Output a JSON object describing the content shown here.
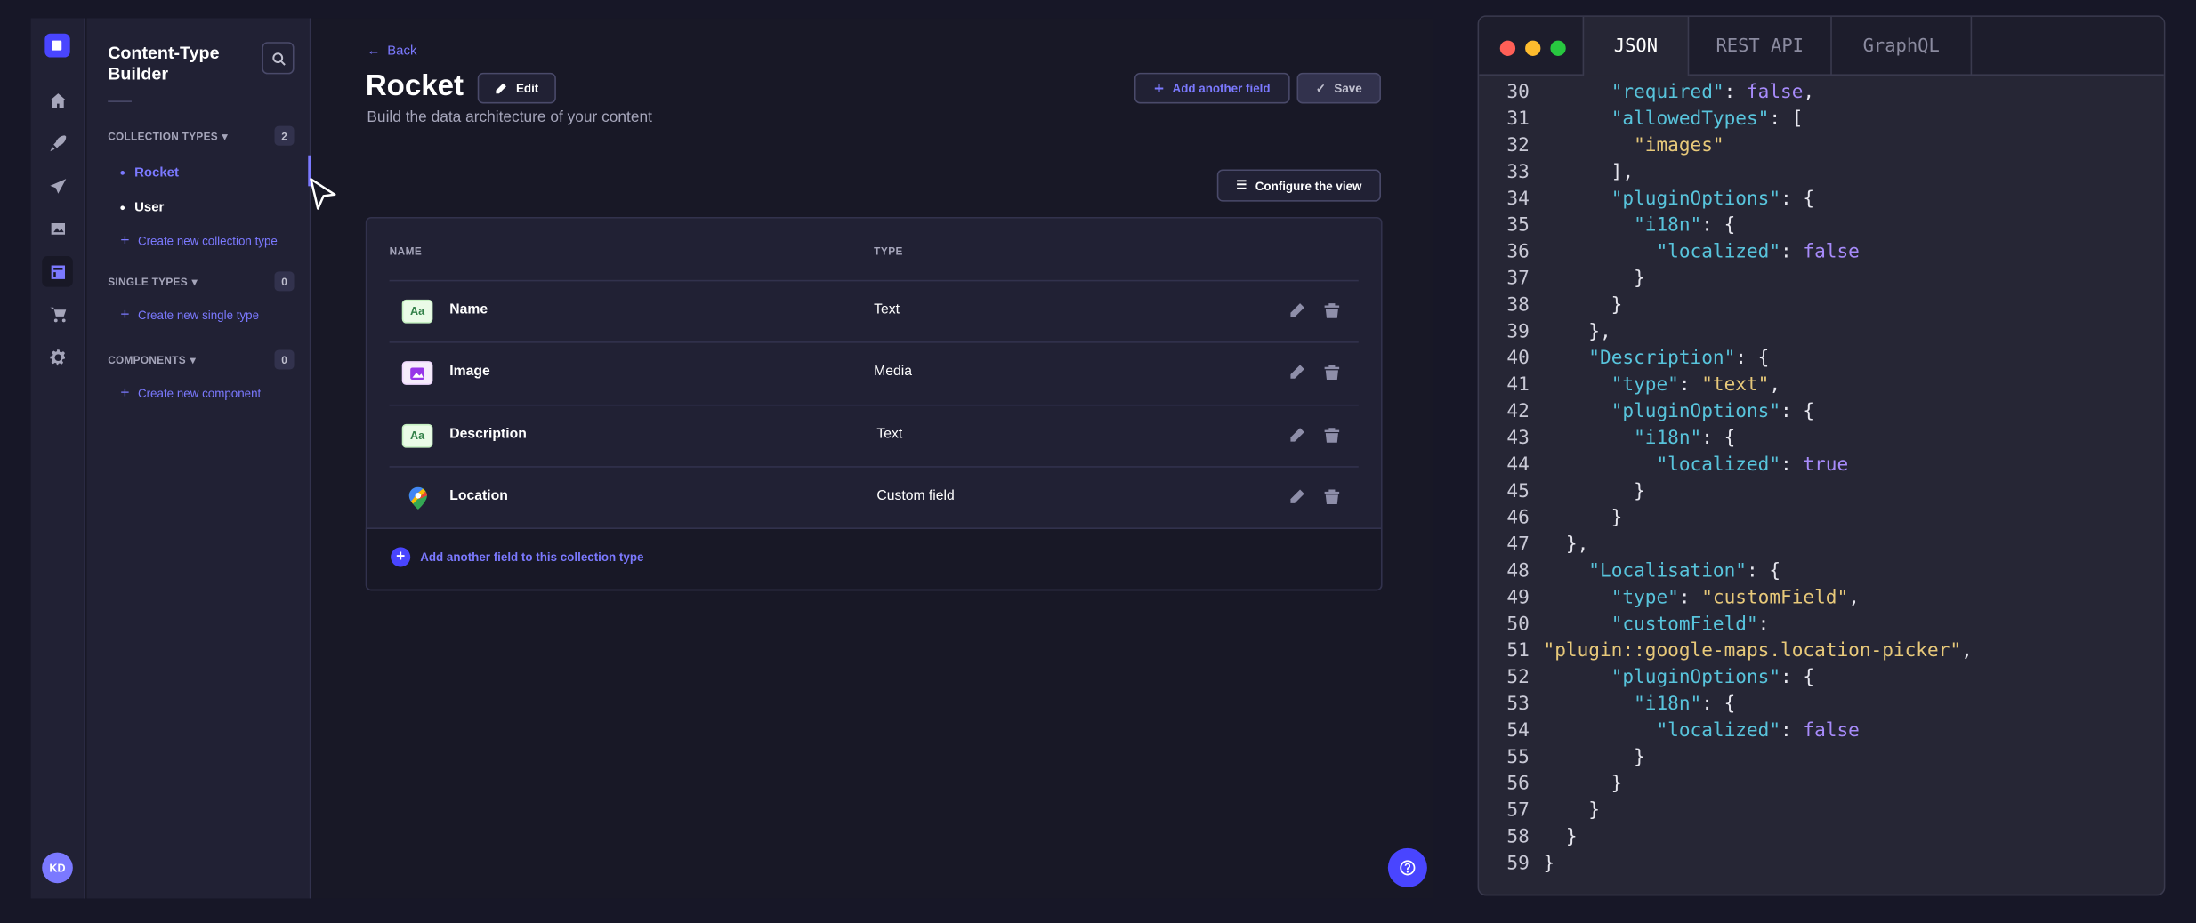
{
  "sidebar": {
    "title": "Content-Type Builder",
    "sections": [
      {
        "label": "COLLECTION TYPES",
        "count": "2",
        "items": [
          "Rocket",
          "User"
        ],
        "create_label": "Create new collection type"
      },
      {
        "label": "SINGLE TYPES",
        "count": "0",
        "items": [],
        "create_label": "Create new single type"
      },
      {
        "label": "COMPONENTS",
        "count": "0",
        "items": [],
        "create_label": "Create new component"
      }
    ],
    "active_item": "Rocket"
  },
  "rail": {
    "icons": [
      "home-icon",
      "content-manager-icon",
      "deploy-icon",
      "media-library-icon",
      "content-type-builder-icon",
      "marketplace-icon",
      "settings-icon"
    ],
    "avatar_initials": "KD"
  },
  "header": {
    "back_label": "Back",
    "title": "Rocket",
    "edit_label": "Edit",
    "subtitle": "Build the data architecture of your content",
    "add_field_label": "Add another field",
    "save_label": "Save",
    "configure_label": "Configure the view"
  },
  "table": {
    "columns": [
      "NAME",
      "TYPE"
    ],
    "rows": [
      {
        "name": "Name",
        "type": "Text",
        "icon": "text-field-icon",
        "icon_text": "Aa"
      },
      {
        "name": "Image",
        "type": "Media",
        "icon": "media-field-icon",
        "icon_text": ""
      },
      {
        "name": "Description",
        "type": "Text",
        "icon": "text-field-icon",
        "icon_text": "Aa"
      },
      {
        "name": "Location",
        "type": "Custom field",
        "icon": "map-pin-icon",
        "icon_text": ""
      }
    ],
    "footer_label": "Add another field to this collection type"
  },
  "code_window": {
    "tabs": [
      "JSON",
      "REST API",
      "GraphQL"
    ],
    "active_tab": "JSON",
    "lines": [
      {
        "n": "30",
        "text": "      \"required\": false,"
      },
      {
        "n": "31",
        "text": "      \"allowedTypes\": ["
      },
      {
        "n": "32",
        "text": "        \"images\""
      },
      {
        "n": "33",
        "text": "      ],"
      },
      {
        "n": "34",
        "text": "      \"pluginOptions\": {"
      },
      {
        "n": "35",
        "text": "        \"i18n\": {"
      },
      {
        "n": "36",
        "text": "          \"localized\": false"
      },
      {
        "n": "37",
        "text": "        }"
      },
      {
        "n": "38",
        "text": "      }"
      },
      {
        "n": "39",
        "text": "    },"
      },
      {
        "n": "40",
        "text": "    \"Description\": {"
      },
      {
        "n": "41",
        "text": "      \"type\": \"text\","
      },
      {
        "n": "42",
        "text": "      \"pluginOptions\": {"
      },
      {
        "n": "43",
        "text": "        \"i18n\": {"
      },
      {
        "n": "44",
        "text": "          \"localized\": true"
      },
      {
        "n": "45",
        "text": "        }"
      },
      {
        "n": "46",
        "text": "      }"
      },
      {
        "n": "47",
        "text": "  },"
      },
      {
        "n": "48",
        "text": "    \"Localisation\": {"
      },
      {
        "n": "49",
        "text": "      \"type\": \"customField\","
      },
      {
        "n": "50",
        "text": "      \"customField\":"
      },
      {
        "n": "51",
        "text": "\"plugin::google-maps.location-picker\","
      },
      {
        "n": "52",
        "text": "      \"pluginOptions\": {"
      },
      {
        "n": "53",
        "text": "        \"i18n\": {"
      },
      {
        "n": "54",
        "text": "          \"localized\": false"
      },
      {
        "n": "55",
        "text": "        }"
      },
      {
        "n": "56",
        "text": "      }"
      },
      {
        "n": "57",
        "text": "    }"
      },
      {
        "n": "58",
        "text": "  }"
      },
      {
        "n": "59",
        "text": "}"
      }
    ]
  },
  "colors": {
    "accent": "#7b79ff",
    "primary": "#4945ff",
    "background": "#181826",
    "surface": "#212134",
    "json_key": "#58c4dc",
    "json_string": "#e8c97a",
    "json_boolean": "#a78bfa"
  }
}
